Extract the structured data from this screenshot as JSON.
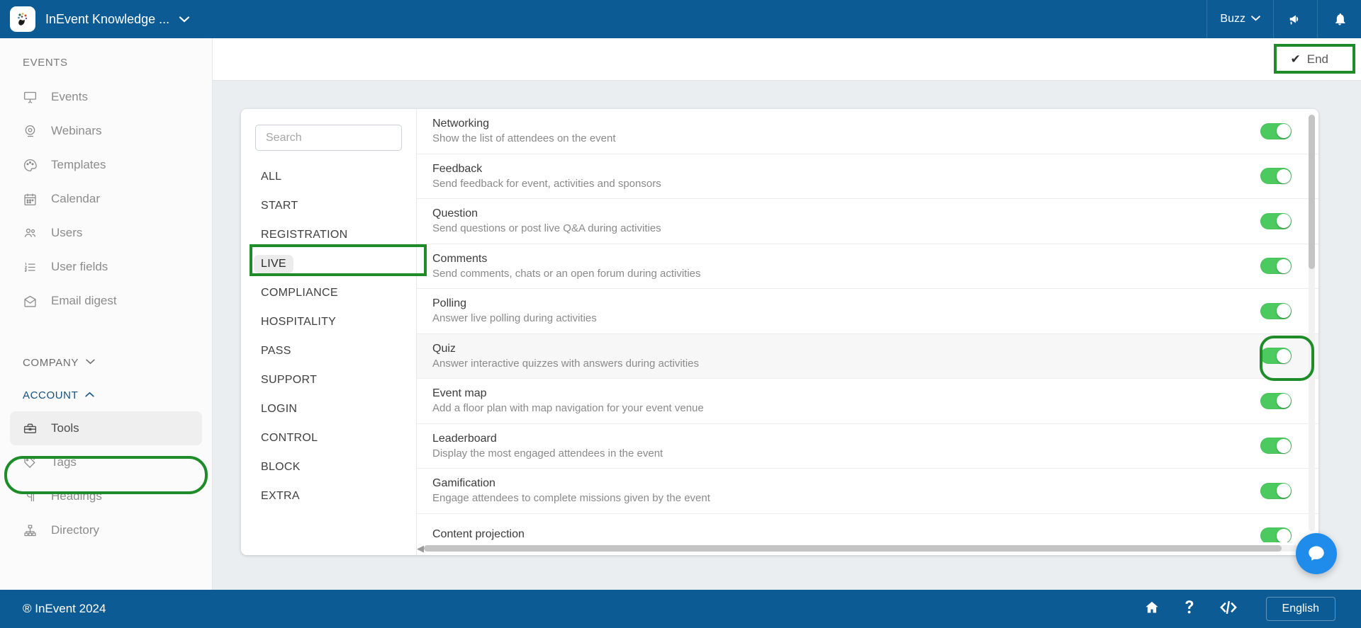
{
  "topbar": {
    "brand_logo_icon": "brain-network-logo",
    "brand_title": "InEvent Knowledge ...",
    "brand_caret": "▾",
    "user_label": "Buzz",
    "user_caret": "▾",
    "megaphone_icon": "megaphone-icon",
    "bell_icon": "bell-icon",
    "bg_color": "#0d5b94"
  },
  "subheader": {
    "end_label": "End",
    "end_check": "✔"
  },
  "sidebar": {
    "events_section_label": "EVENTS",
    "events_items": [
      {
        "label": "Events",
        "icon": "presentation-screen-icon"
      },
      {
        "label": "Webinars",
        "icon": "webcam-icon"
      },
      {
        "label": "Templates",
        "icon": "palette-icon"
      },
      {
        "label": "Calendar",
        "icon": "calendar-icon"
      },
      {
        "label": "Users",
        "icon": "users-icon"
      },
      {
        "label": "User fields",
        "icon": "numbered-list-icon"
      },
      {
        "label": "Email digest",
        "icon": "email-icon"
      }
    ],
    "company_group_label": "COMPANY",
    "company_caret": "⌄",
    "account_group_label": "ACCOUNT",
    "account_caret": "⌃",
    "account_items": [
      {
        "label": "Tools",
        "icon": "toolbox-icon",
        "active": true
      },
      {
        "label": "Tags",
        "icon": "tags-icon",
        "active": false
      },
      {
        "label": "Headings",
        "icon": "pilcrow-icon",
        "active": false
      },
      {
        "label": "Directory",
        "icon": "org-chart-icon",
        "active": false
      }
    ]
  },
  "footer": {
    "copyright": "® InEvent 2024",
    "home_icon": "home-icon",
    "help_icon": "question-mark-icon",
    "code_icon": "code-icon",
    "language": "English"
  },
  "panel": {
    "search": {
      "placeholder": "Search",
      "value": ""
    },
    "categories": [
      {
        "label": "ALL",
        "active": false
      },
      {
        "label": "START",
        "active": false
      },
      {
        "label": "REGISTRATION",
        "active": false
      },
      {
        "label": "LIVE",
        "active": true
      },
      {
        "label": "COMPLIANCE",
        "active": false
      },
      {
        "label": "HOSPITALITY",
        "active": false
      },
      {
        "label": "PASS",
        "active": false
      },
      {
        "label": "SUPPORT",
        "active": false
      },
      {
        "label": "LOGIN",
        "active": false
      },
      {
        "label": "CONTROL",
        "active": false
      },
      {
        "label": "BLOCK",
        "active": false
      },
      {
        "label": "EXTRA",
        "active": false
      }
    ],
    "tools": [
      {
        "title": "Networking",
        "subtitle": "Show the list of attendees on the event",
        "enabled": true,
        "highlighted": false
      },
      {
        "title": "Feedback",
        "subtitle": "Send feedback for event, activities and sponsors",
        "enabled": true,
        "highlighted": false
      },
      {
        "title": "Question",
        "subtitle": "Send questions or post live Q&A during activities",
        "enabled": true,
        "highlighted": false
      },
      {
        "title": "Comments",
        "subtitle": "Send comments, chats or an open forum during activities",
        "enabled": true,
        "highlighted": false
      },
      {
        "title": "Polling",
        "subtitle": "Answer live polling during activities",
        "enabled": true,
        "highlighted": false
      },
      {
        "title": "Quiz",
        "subtitle": "Answer interactive quizzes with answers during activities",
        "enabled": true,
        "highlighted": true
      },
      {
        "title": "Event map",
        "subtitle": "Add a floor plan with map navigation for your event venue",
        "enabled": true,
        "highlighted": false
      },
      {
        "title": "Leaderboard",
        "subtitle": "Display the most engaged attendees in the event",
        "enabled": true,
        "highlighted": false
      },
      {
        "title": "Gamification",
        "subtitle": "Engage attendees to complete missions given by the event",
        "enabled": true,
        "highlighted": false
      },
      {
        "title": "Content projection",
        "subtitle": "",
        "enabled": true,
        "highlighted": false
      }
    ]
  },
  "annotations": {
    "color": "#1e8c28",
    "targets": [
      "tools-sidebar-item",
      "live-category",
      "quiz-toggle",
      "end-button"
    ]
  },
  "chat": {
    "icon": "chat-bubble-icon",
    "color": "#1f8ceb"
  }
}
